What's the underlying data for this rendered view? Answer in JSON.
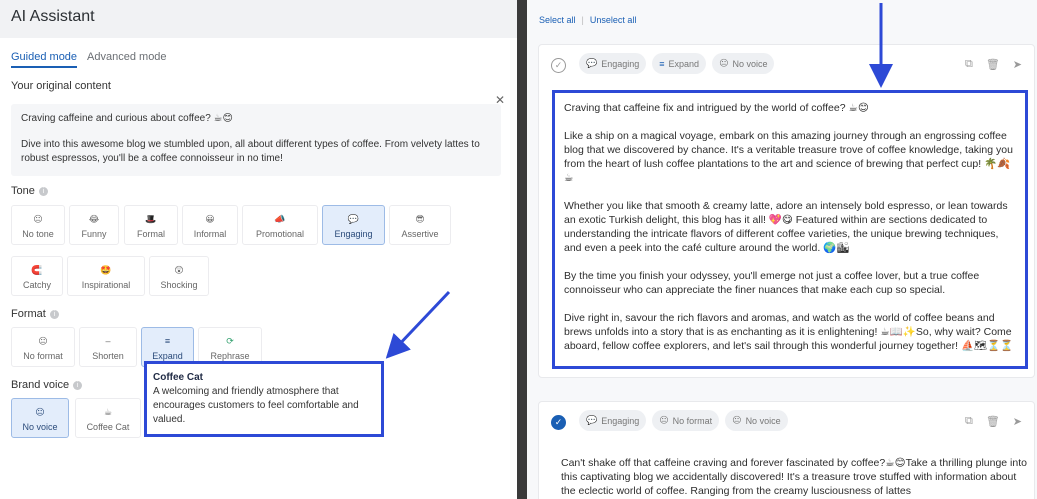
{
  "left": {
    "title": "AI Assistant",
    "tabs": [
      {
        "label": "Guided mode",
        "active": true
      },
      {
        "label": "Advanced mode",
        "active": false
      }
    ],
    "original_content_label": "Your original content",
    "close_icon": "close-icon",
    "original_content": [
      "Craving caffeine and curious about coffee? ☕😊",
      "Dive into this awesome blog we stumbled upon, all about different types of coffee. From velvety lattes to robust espressos, you'll be a coffee connoisseur in no time!"
    ],
    "tone_label": "Tone",
    "tone_options": [
      {
        "label": "No tone",
        "icon": "😐"
      },
      {
        "label": "Funny",
        "icon": "😂"
      },
      {
        "label": "Formal",
        "icon": "🎩"
      },
      {
        "label": "Informal",
        "icon": "😀"
      },
      {
        "label": "Promotional",
        "icon": "📣"
      },
      {
        "label": "Engaging",
        "icon": "💬",
        "selected": true
      },
      {
        "label": "Assertive",
        "icon": "😎"
      },
      {
        "label": "Catchy",
        "icon": "🧲"
      },
      {
        "label": "Inspirational",
        "icon": "🤩"
      },
      {
        "label": "Shocking",
        "icon": "😲"
      }
    ],
    "format_label": "Format",
    "format_options": [
      {
        "label": "No format",
        "icon": "😐"
      },
      {
        "label": "Shorten",
        "icon": "–"
      },
      {
        "label": "Expand",
        "icon": "≡",
        "selected": true
      },
      {
        "label": "Rephrase",
        "icon": "⟳"
      }
    ],
    "brand_voice_label": "Brand voice",
    "brand_voice_options": [
      {
        "label": "No voice",
        "icon": "😐",
        "selected": true
      },
      {
        "label": "Coffee Cat",
        "icon": "☕"
      }
    ],
    "tooltip": {
      "title": "Coffee Cat",
      "body": "A welcoming and friendly atmosphere that encourages customers to feel comfortable and valued."
    }
  },
  "right": {
    "select_all": "Select all",
    "unselect_all": "Unselect all",
    "card1": {
      "tags": [
        "Engaging",
        "Expand",
        "No voice"
      ],
      "paragraphs": [
        "Craving that caffeine fix and intrigued by the world of coffee? ☕😊",
        "Like a ship on a magical voyage, embark on this amazing journey through an engrossing coffee blog that we discovered by chance. It's a veritable treasure trove of coffee knowledge, taking you from the heart of lush coffee plantations to the art and science of brewing that perfect cup! 🌴🍂☕",
        "Whether you like that smooth & creamy latte, adore an intensely bold espresso, or lean towards an exotic Turkish delight, this blog has it all! 💖😋 Featured within are sections dedicated to understanding the intricate flavors of different coffee varieties, the unique brewing techniques, and even a peek into the café culture around the world. 🌍🏙",
        "By the time you finish your odyssey, you'll emerge not just a coffee lover, but a true coffee connoisseur who can appreciate the finer nuances that make each cup so special.",
        "Dive right in, savour the rich flavors and aromas, and watch as the world of coffee beans and brews unfolds into a story that is as enchanting as it is enlightening! ☕📖✨So, why wait? Come aboard, fellow coffee explorers, and let's sail through this wonderful journey together! ⛵🗺⏳⏳"
      ]
    },
    "card2": {
      "tags": [
        "Engaging",
        "No format",
        "No voice"
      ],
      "text": "Can't shake off that caffeine craving and forever fascinated by coffee?☕😊Take a thrilling plunge into this captivating blog we accidentally discovered! It's a treasure trove stuffed with information about the eclectic world of coffee. Ranging from the creamy lusciousness of lattes"
    }
  },
  "colors": {
    "accent": "#1a5fb4",
    "highlight": "#2d49d6",
    "selected_chip": "#e3edfb"
  }
}
